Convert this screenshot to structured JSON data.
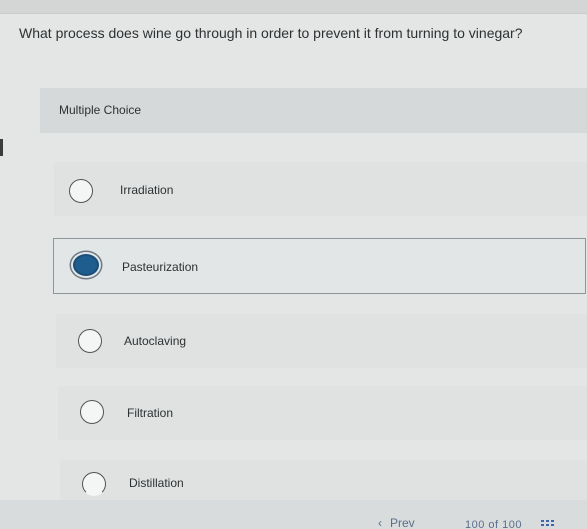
{
  "question": "What process does wine go through in order to prevent it from turning to vinegar?",
  "section_label": "Multiple Choice",
  "options": [
    {
      "label": "Irradiation",
      "selected": false
    },
    {
      "label": "Pasteurization",
      "selected": true
    },
    {
      "label": "Autoclaving",
      "selected": false
    },
    {
      "label": "Filtration",
      "selected": false
    },
    {
      "label": "Distillation",
      "selected": false
    }
  ],
  "footer": {
    "prev_label": "Prev",
    "counter": "100 of 100"
  },
  "colors": {
    "selected_radio": "#1f5d8f",
    "background": "#e3e6e5"
  }
}
